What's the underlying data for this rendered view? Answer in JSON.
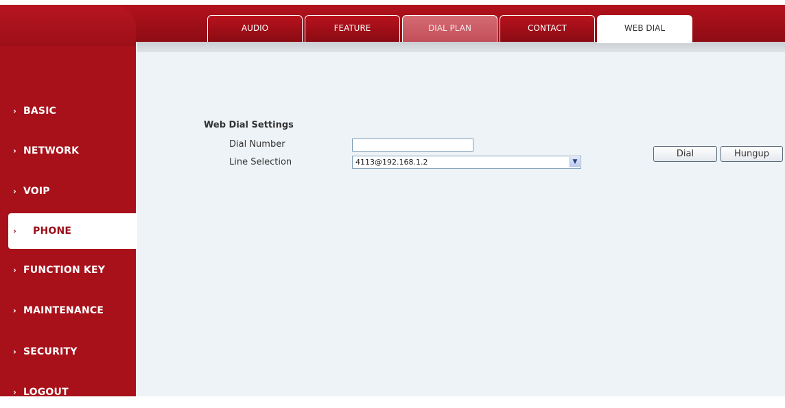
{
  "tabs": [
    {
      "label": "AUDIO"
    },
    {
      "label": "FEATURE"
    },
    {
      "label": "DIAL PLAN"
    },
    {
      "label": "CONTACT"
    },
    {
      "label": "WEB DIAL"
    }
  ],
  "active_tab": "WEB DIAL",
  "sidebar": {
    "items": [
      {
        "label": "BASIC"
      },
      {
        "label": "NETWORK"
      },
      {
        "label": "VOIP"
      },
      {
        "label": "PHONE"
      },
      {
        "label": "FUNCTION KEY"
      },
      {
        "label": "MAINTENANCE"
      },
      {
        "label": "SECURITY"
      },
      {
        "label": "LOGOUT"
      }
    ],
    "active_item": "PHONE",
    "chevron": "›"
  },
  "form": {
    "title": "Web Dial Settings",
    "dial_number_label": "Dial Number",
    "dial_number_value": "",
    "line_selection_label": "Line Selection",
    "line_selection_value": "4113@192.168.1.2"
  },
  "buttons": {
    "dial": "Dial",
    "hungup": "Hungup"
  },
  "colors": {
    "brand_red": "#a8111a",
    "content_bg": "#eef3f7"
  }
}
